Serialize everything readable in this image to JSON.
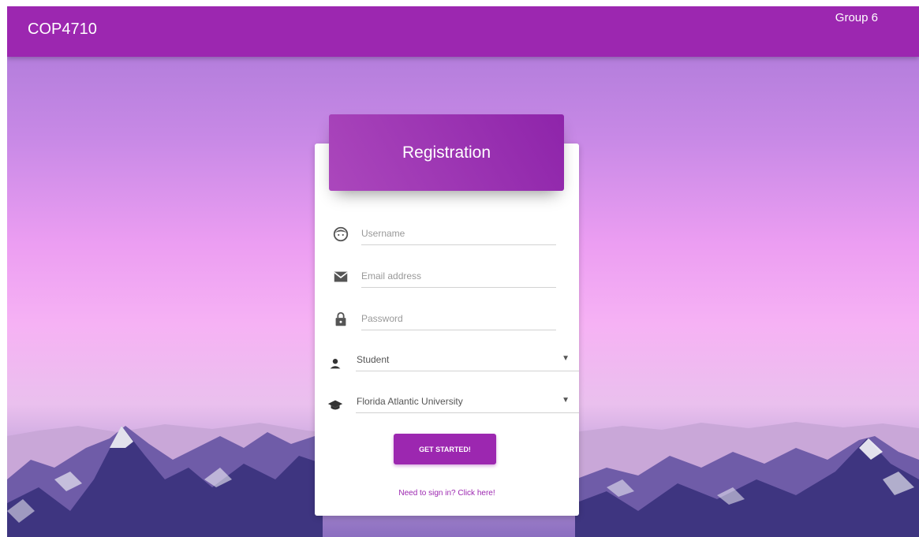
{
  "header": {
    "brand": "COP4710",
    "group": "Group 6"
  },
  "card": {
    "title": "Registration",
    "fields": {
      "username": {
        "placeholder": "Username",
        "icon": "face-icon"
      },
      "email": {
        "placeholder": "Email address",
        "icon": "mail-icon"
      },
      "password": {
        "placeholder": "Password",
        "icon": "lock-icon"
      }
    },
    "role_select": {
      "value": "Student",
      "icon": "person-icon"
    },
    "university_select": {
      "value": "Florida Atlantic University",
      "icon": "school-icon"
    },
    "submit_label": "GET STARTED!",
    "signin_link": "Need to sign in? Click here!"
  },
  "colors": {
    "primary": "#9c27b0",
    "header_gradient_start": "#ab47bc",
    "header_gradient_end": "#8e24aa"
  }
}
